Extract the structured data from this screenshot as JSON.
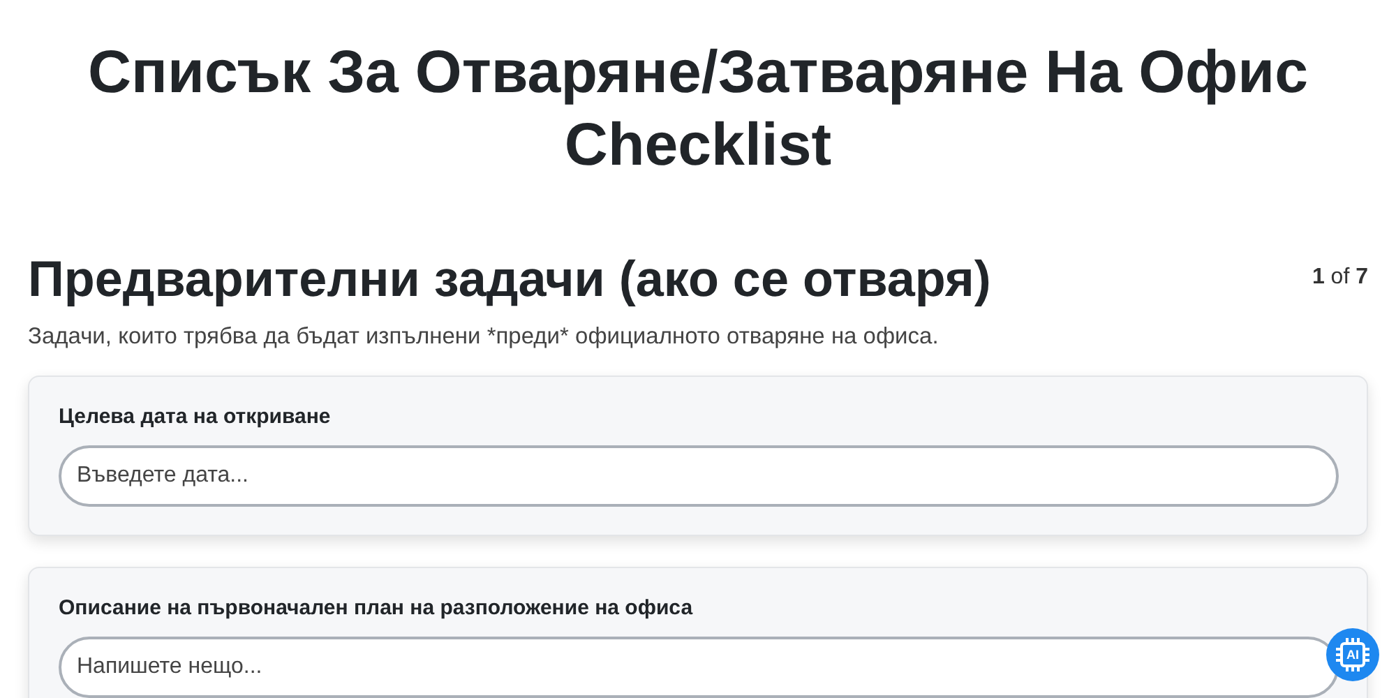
{
  "title": "Списък За Отваряне/Затваряне На Офис Checklist",
  "section": {
    "heading": "Предварителни задачи (ако се отваря)",
    "pager": "**1** of **7**",
    "description": "Задачи, които трябва да бъдат изпълнени *преди* официалното отваряне на офиса."
  },
  "fields": [
    {
      "label": "Целева дата на откриване",
      "placeholder": "Въведете дата..."
    },
    {
      "label": "Описание на първоначален план на разположение на офиса",
      "placeholder": "Напишете нещо..."
    }
  ],
  "ai_badge": {
    "text": "AI"
  }
}
